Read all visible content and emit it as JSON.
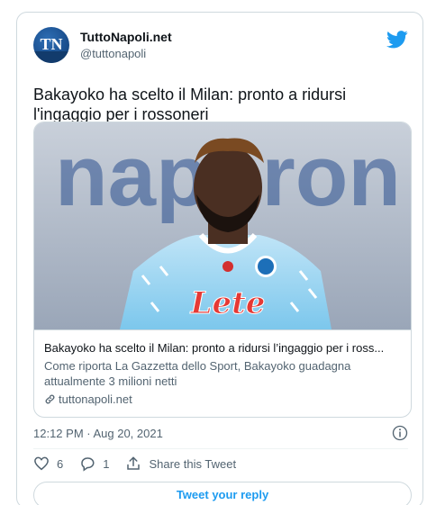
{
  "account": {
    "name": "TuttoNapoli.net",
    "handle": "@tuttonapoli",
    "avatar_text": "TN",
    "avatar_color": "#1a4f8f"
  },
  "tweet": {
    "text": "Bakayoko ha scelto il Milan: pronto a ridursi l'ingaggio per i rossoneri"
  },
  "link_card": {
    "image_backdrop_text": "naporon",
    "shirt_sponsor": "Lete",
    "title": "Bakayoko ha scelto il Milan: pronto a ridursi l’ingaggio per i ross...",
    "description": "Come riporta La Gazzetta dello Sport, Bakayoko guadagna attualmente 3 milioni netti",
    "domain": "tuttonapoli.net",
    "link_icon": "link-icon"
  },
  "meta": {
    "timestamp": "12:12 PM · Aug 20, 2021",
    "info_icon": "info-icon"
  },
  "actions": {
    "like_count": "6",
    "reply_count": "1",
    "share_label": "Share this Tweet"
  },
  "reply_button": {
    "label": "Tweet your reply"
  },
  "colors": {
    "accent": "#1d9bf0",
    "text_primary": "#0f1419",
    "text_secondary": "#536471",
    "border": "#cfd9de"
  }
}
